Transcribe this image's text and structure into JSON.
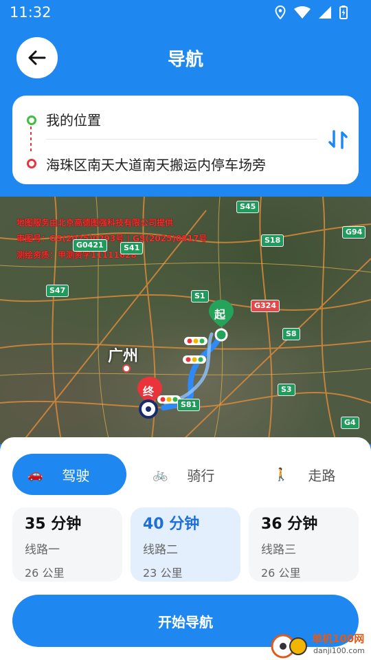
{
  "status": {
    "time": "11:32"
  },
  "header": {
    "title": "导航"
  },
  "route": {
    "origin": "我的位置",
    "destination": "海珠区南天大道南天搬运内停车场旁"
  },
  "map": {
    "notice_lines": [
      "地图服务由北京高德图强科技有限公司提供",
      "审图号：GS(2025)0293号 | GS(2025)0817号",
      "测绘资质：甲测资字11111628"
    ],
    "city": "广州",
    "shields": [
      "S45",
      "G94",
      "G0421",
      "S18",
      "S41",
      "S47",
      "S1",
      "G324",
      "S8",
      "S3",
      "S81",
      "G4"
    ],
    "marker_start": "起",
    "marker_end": "终"
  },
  "modes": [
    {
      "label": "驾驶",
      "icon": "car-icon",
      "selected": true
    },
    {
      "label": "骑行",
      "icon": "bicycle-icon",
      "selected": false
    },
    {
      "label": "走路",
      "icon": "walking-icon",
      "selected": false
    }
  ],
  "plans": [
    {
      "time": "35 分钟",
      "name": "线路一",
      "distance": "26 公里",
      "selected": false
    },
    {
      "time": "40 分钟",
      "name": "线路二",
      "distance": "23 公里",
      "selected": true
    },
    {
      "time": "36 分钟",
      "name": "线路三",
      "distance": "26 公里",
      "selected": false
    }
  ],
  "start_button": "开始导航",
  "watermark": {
    "site": "单机100网",
    "url": "danji100.com"
  },
  "colors": {
    "accent": "#1e88f0",
    "origin": "#3fbf3f",
    "destination": "#e8343a"
  }
}
